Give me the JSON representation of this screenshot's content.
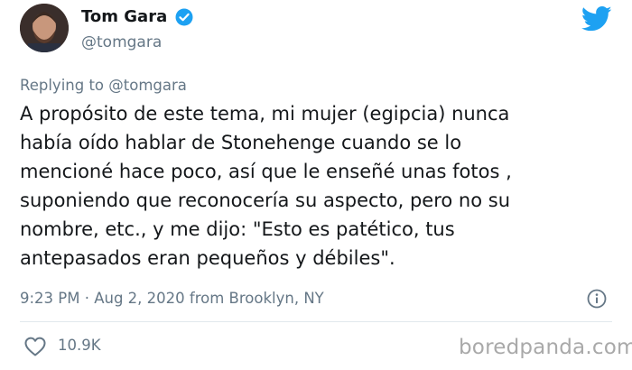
{
  "author": {
    "display_name": "Tom Gara",
    "handle": "@tomgara",
    "verified": true,
    "avatar_icon": "avatar-photo"
  },
  "brand": {
    "icon": "twitter-bird-icon",
    "color": "#1da1f2"
  },
  "reply": {
    "label": "Replying to @tomgara"
  },
  "tweet": {
    "text": "A propósito de este tema, mi mujer (egipcia) nunca\nhabía oído hablar de Stonehenge cuando se lo\nmencioné hace poco, así que le enseñé unas fotos ,\nsuponiendo que reconocería su aspecto, pero no su\nnombre, etc., y me dijo: \"Esto es patético, tus\nantepasados eran pequeños y débiles\".",
    "timestamp": "9:23 PM · Aug 2, 2020 from Brooklyn, NY"
  },
  "actions": {
    "like_icon": "heart-icon",
    "like_count": "10.9K",
    "info_icon": "info-icon"
  },
  "watermark": {
    "text": "boredpanda.com"
  },
  "colors": {
    "secondary_text": "#657786",
    "primary_text": "#14171a",
    "divider": "#e1e8ed"
  }
}
